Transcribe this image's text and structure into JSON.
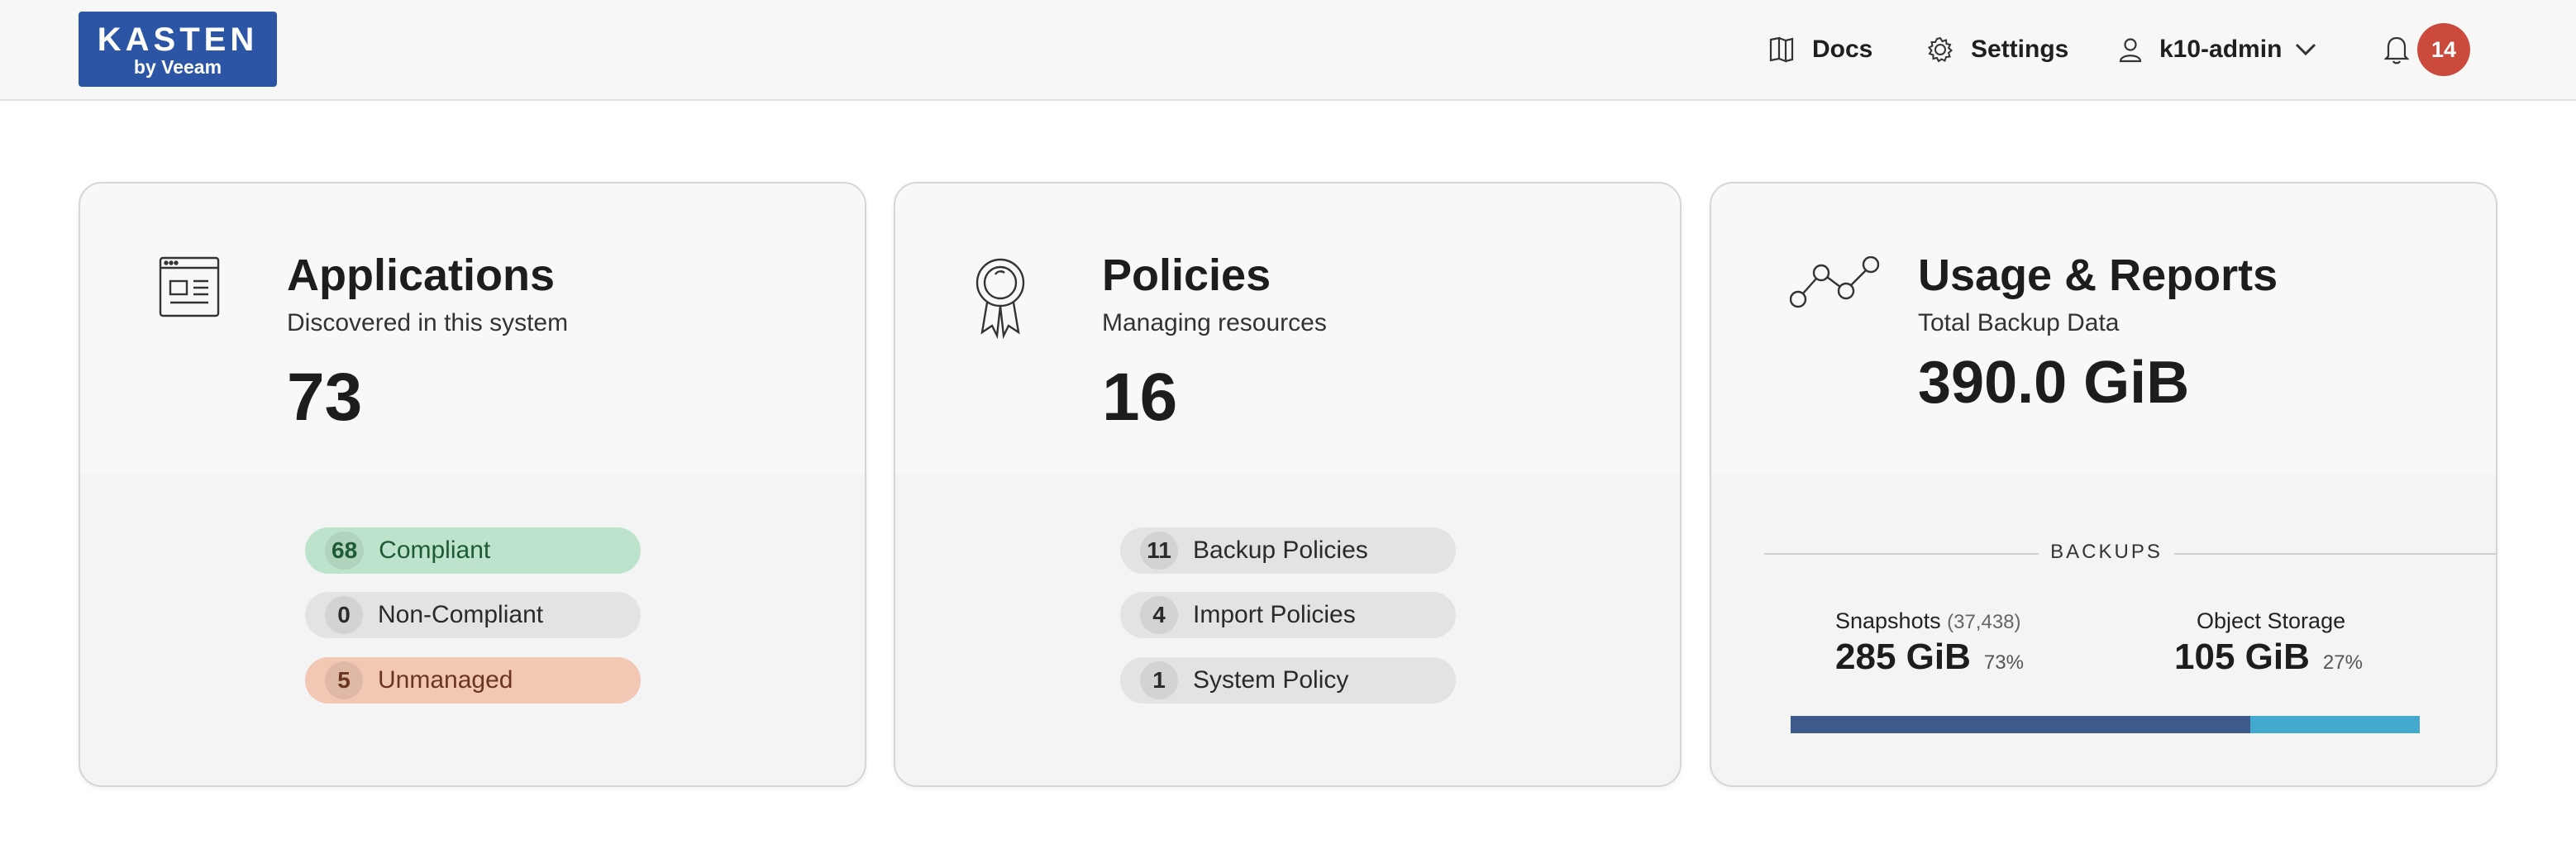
{
  "header": {
    "logo_brand": "KASTEN",
    "logo_sub": "by Veeam",
    "docs_label": "Docs",
    "settings_label": "Settings",
    "user_label": "k10-admin",
    "notification_count": "14"
  },
  "cards": {
    "applications": {
      "title": "Applications",
      "subtitle": "Discovered in this system",
      "value": "73",
      "items": [
        {
          "count": "68",
          "label": "Compliant"
        },
        {
          "count": "0",
          "label": "Non-Compliant"
        },
        {
          "count": "5",
          "label": "Unmanaged"
        }
      ]
    },
    "policies": {
      "title": "Policies",
      "subtitle": "Managing resources",
      "value": "16",
      "items": [
        {
          "count": "11",
          "label": "Backup Policies"
        },
        {
          "count": "4",
          "label": "Import Policies"
        },
        {
          "count": "1",
          "label": "System Policy"
        }
      ]
    },
    "usage": {
      "title": "Usage & Reports",
      "subtitle": "Total Backup Data",
      "value": "390.0 GiB",
      "backups_label": "BACKUPS",
      "snapshots": {
        "label": "Snapshots",
        "count": "(37,438)",
        "value": "285 GiB",
        "percent": "73%",
        "fraction": 0.73,
        "color": "#3d5a8c"
      },
      "object_storage": {
        "label": "Object Storage",
        "value": "105 GiB",
        "percent": "27%",
        "fraction": 0.27,
        "color": "#44a9cf"
      }
    }
  },
  "colors": {
    "brand": "#2d55a6",
    "badge": "#cb4a3c",
    "compliant": "#bde3cc",
    "unmanaged": "#f2c7b3"
  },
  "icons": {
    "docs": "book-icon",
    "settings": "gear-icon",
    "user": "user-icon",
    "notifications": "bell-icon",
    "applications": "browser-window-icon",
    "policies": "award-ribbon-icon",
    "usage": "line-graph-icon"
  }
}
